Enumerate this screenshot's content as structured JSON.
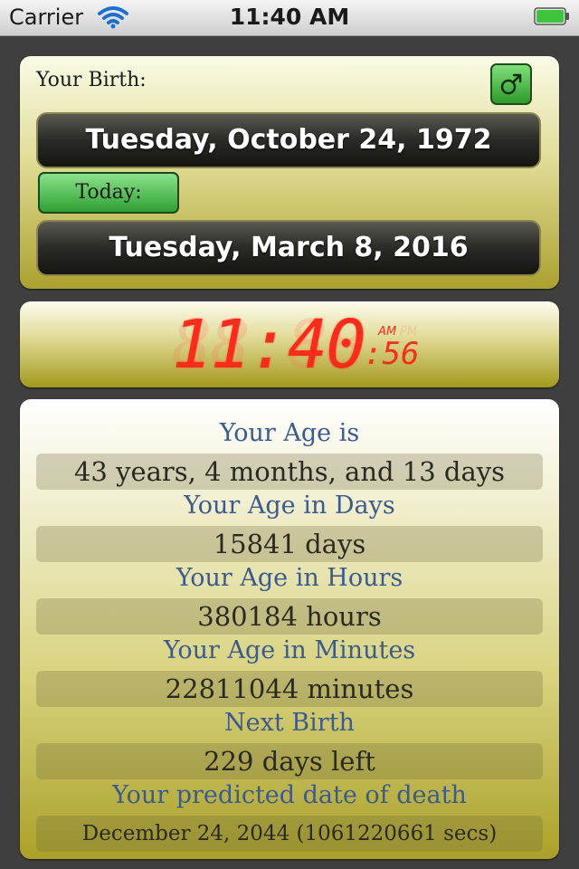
{
  "status_bar": {
    "carrier": "Carrier",
    "time": "11:40 AM"
  },
  "birth": {
    "label": "Your Birth:",
    "gender_icon": "male-symbol-icon",
    "date": "Tuesday, October 24, 1972"
  },
  "today": {
    "button_label": "Today:",
    "date": "Tuesday, March 8, 2016"
  },
  "clock": {
    "time": "11:40",
    "seconds": ":56",
    "am_label": "AM",
    "pm_label": "PM",
    "color": "#ff2a1a"
  },
  "age": {
    "rows": [
      {
        "label": "Your Age is",
        "value": "43 years, 4 months, and 13 days"
      },
      {
        "label": "Your Age in Days",
        "value": "15841  days"
      },
      {
        "label": "Your Age in Hours",
        "value": "380184  hours"
      },
      {
        "label": "Your Age in Minutes",
        "value": "22811044  minutes"
      },
      {
        "label": "Next Birth",
        "value": "229 days left"
      },
      {
        "label": "Your predicted date of death",
        "value": "December 24, 2044 (1061220661 secs)"
      }
    ]
  },
  "colors": {
    "label_blue": "#3b5b8e",
    "button_green": "#2fa033",
    "background": "#3f3f3f"
  }
}
